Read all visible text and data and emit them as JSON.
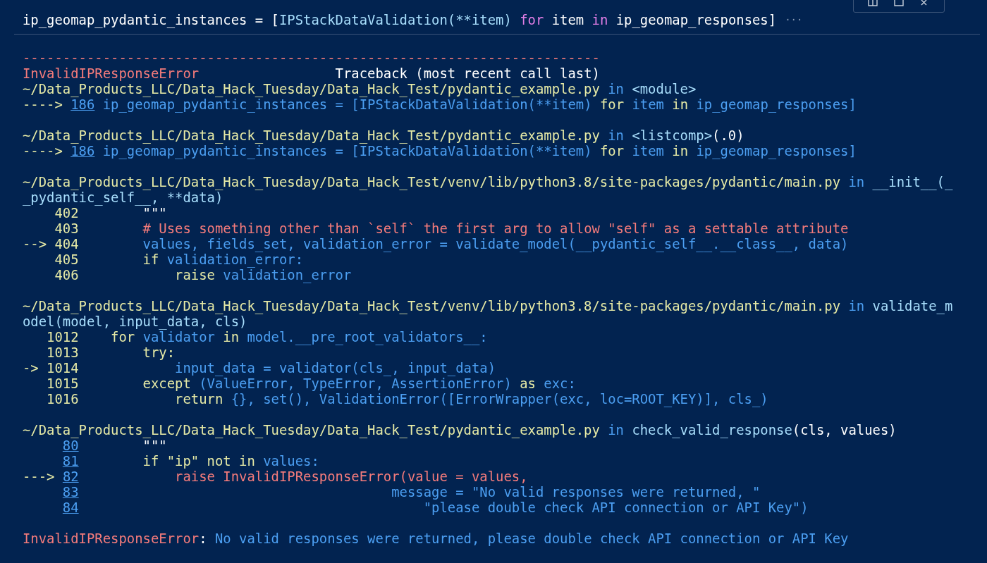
{
  "toolbar": {
    "buttons": [
      {
        "kind": "split"
      },
      {
        "kind": "maximize"
      },
      {
        "kind": "close"
      }
    ]
  },
  "input": {
    "segments": [
      {
        "text": "ip_geomap_pydantic_instances = [",
        "kind": "w"
      },
      {
        "text": "IPStackDataValidation(**item)",
        "kind": "c"
      },
      {
        "text": " for ",
        "kind": "m"
      },
      {
        "text": "item ",
        "kind": "w"
      },
      {
        "text": "in ",
        "kind": "m"
      },
      {
        "text": "ip_geomap_responses]",
        "kind": "w"
      }
    ],
    "overflow_marker": "···"
  },
  "output": [
    {
      "kind": "text",
      "segments": [
        {
          "text": "------------------------------------------------------------------------",
          "kind": "r"
        }
      ]
    },
    {
      "kind": "text",
      "segments": [
        {
          "text": "InvalidIPResponseError",
          "kind": "r"
        },
        {
          "text": "                 Traceback (most recent call last)",
          "kind": "w"
        }
      ]
    },
    {
      "kind": "text",
      "segments": [
        {
          "text": "~/Data_Products_LLC/Data_Hack_Tuesday/Data_Hack_Test/pydantic_example.py",
          "kind": "y"
        },
        {
          "text": " in ",
          "kind": "b"
        },
        {
          "text": "<module>",
          "kind": "c"
        }
      ]
    },
    {
      "kind": "text",
      "segments": [
        {
          "text": "----> ",
          "kind": "y"
        },
        {
          "text": "186",
          "kind": "link"
        },
        {
          "text": " ip_geomap_pydantic_instances = [IPStackDataValidation(**item) ",
          "kind": "b"
        },
        {
          "text": "for ",
          "kind": "y"
        },
        {
          "text": "item ",
          "kind": "b"
        },
        {
          "text": "in ",
          "kind": "y"
        },
        {
          "text": "ip_geomap_responses]",
          "kind": "b"
        }
      ]
    },
    {
      "kind": "blank"
    },
    {
      "kind": "text",
      "segments": [
        {
          "text": "~/Data_Products_LLC/Data_Hack_Tuesday/Data_Hack_Test/pydantic_example.py",
          "kind": "y"
        },
        {
          "text": " in ",
          "kind": "b"
        },
        {
          "text": "<listcomp>",
          "kind": "c"
        },
        {
          "text": "(.0)",
          "kind": "w"
        }
      ]
    },
    {
      "kind": "text",
      "segments": [
        {
          "text": "----> ",
          "kind": "y"
        },
        {
          "text": "186",
          "kind": "link"
        },
        {
          "text": " ip_geomap_pydantic_instances = [IPStackDataValidation(**item) ",
          "kind": "b"
        },
        {
          "text": "for ",
          "kind": "y"
        },
        {
          "text": "item ",
          "kind": "b"
        },
        {
          "text": "in ",
          "kind": "y"
        },
        {
          "text": "ip_geomap_responses]",
          "kind": "b"
        }
      ]
    },
    {
      "kind": "blank"
    },
    {
      "kind": "text",
      "segments": [
        {
          "text": "~/Data_Products_LLC/Data_Hack_Tuesday/Data_Hack_Test/venv/lib/python3.8/site-packages/pydantic/main.py",
          "kind": "y"
        },
        {
          "text": " in ",
          "kind": "b"
        },
        {
          "text": "__init__(_",
          "kind": "c"
        }
      ]
    },
    {
      "kind": "text",
      "segments": [
        {
          "text": "_pydantic_self__, **data)",
          "kind": "c"
        }
      ]
    },
    {
      "kind": "text",
      "segments": [
        {
          "text": "    402",
          "kind": "y"
        },
        {
          "text": "        \"\"\"",
          "kind": "w"
        }
      ]
    },
    {
      "kind": "text",
      "segments": [
        {
          "text": "    403",
          "kind": "y"
        },
        {
          "text": "        # Uses something other than `self` the first arg to allow \"self\" as a settable attribute",
          "kind": "r"
        }
      ]
    },
    {
      "kind": "text",
      "segments": [
        {
          "text": "--> 404",
          "kind": "y"
        },
        {
          "text": "        values, fields_set, validation_error = validate_model(__pydantic_self__.__class__, data)",
          "kind": "b"
        }
      ]
    },
    {
      "kind": "text",
      "segments": [
        {
          "text": "    405",
          "kind": "y"
        },
        {
          "text": "        if ",
          "kind": "y"
        },
        {
          "text": "validation_error:",
          "kind": "b"
        }
      ]
    },
    {
      "kind": "text",
      "segments": [
        {
          "text": "    406",
          "kind": "y"
        },
        {
          "text": "            raise ",
          "kind": "y"
        },
        {
          "text": "validation_error",
          "kind": "b"
        }
      ]
    },
    {
      "kind": "blank"
    },
    {
      "kind": "text",
      "segments": [
        {
          "text": "~/Data_Products_LLC/Data_Hack_Tuesday/Data_Hack_Test/venv/lib/python3.8/site-packages/pydantic/main.py",
          "kind": "y"
        },
        {
          "text": " in ",
          "kind": "b"
        },
        {
          "text": "validate_m",
          "kind": "c"
        }
      ]
    },
    {
      "kind": "text",
      "segments": [
        {
          "text": "odel(model, input_data, cls)",
          "kind": "c"
        }
      ]
    },
    {
      "kind": "text",
      "segments": [
        {
          "text": "   1012",
          "kind": "y"
        },
        {
          "text": "    for ",
          "kind": "y"
        },
        {
          "text": "validator ",
          "kind": "b"
        },
        {
          "text": "in ",
          "kind": "y"
        },
        {
          "text": "model.__pre_root_validators__:",
          "kind": "b"
        }
      ]
    },
    {
      "kind": "text",
      "segments": [
        {
          "text": "   1013",
          "kind": "y"
        },
        {
          "text": "        try:",
          "kind": "y"
        }
      ]
    },
    {
      "kind": "text",
      "segments": [
        {
          "text": "-> 1014",
          "kind": "y"
        },
        {
          "text": "            input_data = validator(cls_, input_data)",
          "kind": "b"
        }
      ]
    },
    {
      "kind": "text",
      "segments": [
        {
          "text": "   1015",
          "kind": "y"
        },
        {
          "text": "        except ",
          "kind": "y"
        },
        {
          "text": "(ValueError, TypeError, AssertionError) ",
          "kind": "b"
        },
        {
          "text": "as ",
          "kind": "y"
        },
        {
          "text": "exc:",
          "kind": "b"
        }
      ]
    },
    {
      "kind": "text",
      "segments": [
        {
          "text": "   1016",
          "kind": "y"
        },
        {
          "text": "            return ",
          "kind": "y"
        },
        {
          "text": "{}, set(), ValidationError([ErrorWrapper(exc, loc=ROOT_KEY)], cls_)",
          "kind": "b"
        }
      ]
    },
    {
      "kind": "blank"
    },
    {
      "kind": "text",
      "segments": [
        {
          "text": "~/Data_Products_LLC/Data_Hack_Tuesday/Data_Hack_Test/pydantic_example.py",
          "kind": "y"
        },
        {
          "text": " in ",
          "kind": "b"
        },
        {
          "text": "check_valid_response",
          "kind": "c"
        },
        {
          "text": "(cls, values)",
          "kind": "w"
        }
      ]
    },
    {
      "kind": "numbered",
      "segments": [
        {
          "text": "80",
          "kind": "link"
        },
        {
          "text": "        \"\"\"",
          "kind": "w"
        }
      ]
    },
    {
      "kind": "numbered",
      "segments": [
        {
          "text": "81",
          "kind": "link"
        },
        {
          "text": "        if \"ip\" not in ",
          "kind": "y"
        },
        {
          "text": "values:",
          "kind": "b"
        }
      ]
    },
    {
      "kind": "text",
      "segments": [
        {
          "text": "---> ",
          "kind": "y"
        },
        {
          "text": "82",
          "kind": "link"
        },
        {
          "text": "            raise InvalidIPResponseError(value = values,",
          "kind": "r"
        }
      ]
    },
    {
      "kind": "numbered",
      "segments": [
        {
          "text": "83",
          "kind": "link"
        },
        {
          "text": "                                       message = \"No valid responses were returned, \"",
          "kind": "b"
        }
      ]
    },
    {
      "kind": "numbered",
      "segments": [
        {
          "text": "84",
          "kind": "link"
        },
        {
          "text": "                                           \"please double check API connection or API Key\")",
          "kind": "b"
        }
      ]
    },
    {
      "kind": "blank"
    },
    {
      "kind": "text",
      "segments": [
        {
          "text": "InvalidIPResponseError",
          "kind": "r"
        },
        {
          "text": ": ",
          "kind": "w"
        },
        {
          "text": "No valid responses were returned, please double check API connection or API Key",
          "kind": "b"
        }
      ]
    }
  ]
}
